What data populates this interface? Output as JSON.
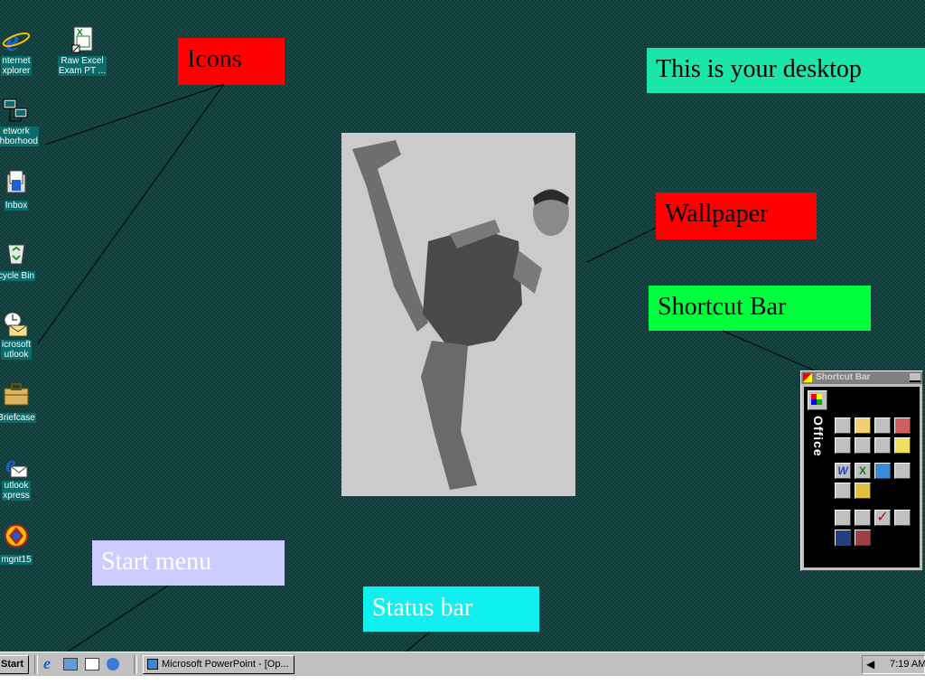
{
  "desktop": {
    "icons": [
      {
        "label": "nternet\nxplorer"
      },
      {
        "label": "Raw Excel\nExam PT ..."
      },
      {
        "label": "etwork\nghborhood"
      },
      {
        "label": "Inbox"
      },
      {
        "label": "cycle Bin"
      },
      {
        "label": "icrosoft\nutlook"
      },
      {
        "label": "Briefcase"
      },
      {
        "label": "utlook\nxpress"
      },
      {
        "label": "mgnt15"
      }
    ]
  },
  "callouts": {
    "icons": {
      "text": "Icons",
      "color": "#ff0000"
    },
    "desktop": {
      "text": "This is your desktop",
      "color": "#19e6a8"
    },
    "wallpaper": {
      "text": "Wallpaper",
      "color": "#ff0000"
    },
    "shortcut_bar": {
      "text": "Shortcut Bar",
      "color": "#00ff3c"
    },
    "start_menu": {
      "text": "Start menu",
      "color": "#ccccff"
    },
    "status_bar": {
      "text": "Status bar",
      "color": "#11f0f0"
    }
  },
  "shortcut_bar": {
    "title": "Shortcut Bar",
    "section": "Office"
  },
  "taskbar": {
    "start_label": "Start",
    "task_label": "Microsoft PowerPoint - [Op...",
    "clock": "7:19 AM"
  },
  "colors": {
    "desktop": "#0e3c3a",
    "taskbar": "#c0c0c0"
  }
}
